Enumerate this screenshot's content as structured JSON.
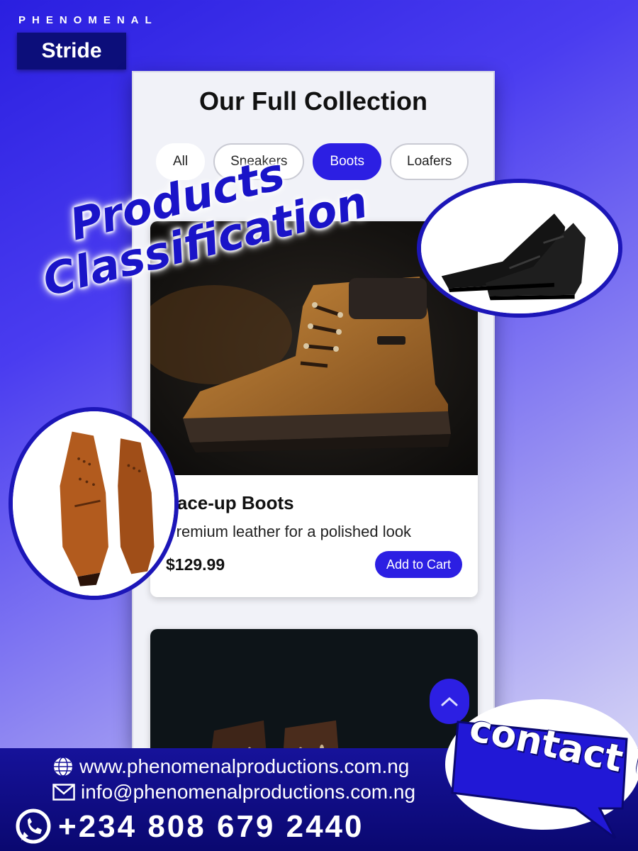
{
  "brand": {
    "top_label": "PHENOMENAL",
    "name": "Stride"
  },
  "app": {
    "title": "Our Full Collection",
    "filters": [
      {
        "label": "All",
        "active": false
      },
      {
        "label": "Sneakers",
        "active": false
      },
      {
        "label": "Boots",
        "active": true
      },
      {
        "label": "Loafers",
        "active": false
      }
    ],
    "products": [
      {
        "name": "Lace-up Boots",
        "description": "Premium leather for a polished look",
        "price": "$129.99",
        "button": "Add to Cart"
      }
    ]
  },
  "headline": {
    "line1": "Products",
    "line2": "Classification"
  },
  "footer": {
    "website": "www.phenomenalproductions.com.ng",
    "email": "info@phenomenalproductions.com.ng",
    "phone": "+234 808 679 2440"
  },
  "cta": {
    "label": "contact us"
  },
  "icons": {
    "globe": "globe-icon",
    "mail": "mail-icon",
    "phone": "whatsapp-icon",
    "scroll_top": "chevron-up-icon"
  },
  "colors": {
    "accent": "#2c1fe3",
    "brand_dark": "#0c0e7a",
    "headline": "#1a14c8"
  }
}
